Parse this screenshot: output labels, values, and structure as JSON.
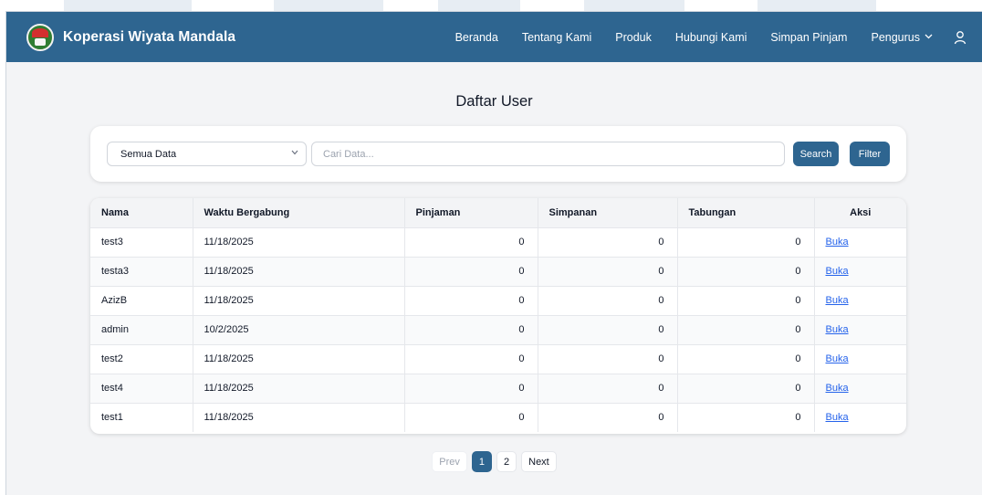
{
  "brand": {
    "name": "Koperasi Wiyata Mandala"
  },
  "nav": {
    "links": [
      "Beranda",
      "Tentang Kami",
      "Produk",
      "Hubungi Kami",
      "Simpan Pinjam",
      "Pengurus"
    ],
    "user_icon": "user-icon"
  },
  "page": {
    "title": "Daftar User"
  },
  "search": {
    "filter_selected": "Semua Data",
    "placeholder": "Cari Data...",
    "search_label": "Search",
    "filter_label": "Filter"
  },
  "table": {
    "headers": [
      "Nama",
      "Waktu Bergabung",
      "Pinjaman",
      "Simpanan",
      "Tabungan",
      "Aksi"
    ],
    "rows": [
      {
        "nama": "test3",
        "waktu": "11/18/2025",
        "pinjaman": "0",
        "simpanan": "0",
        "tabungan": "0",
        "aksi": "Buka"
      },
      {
        "nama": "testa3",
        "waktu": "11/18/2025",
        "pinjaman": "0",
        "simpanan": "0",
        "tabungan": "0",
        "aksi": "Buka"
      },
      {
        "nama": "AzizB",
        "waktu": "11/18/2025",
        "pinjaman": "0",
        "simpanan": "0",
        "tabungan": "0",
        "aksi": "Buka"
      },
      {
        "nama": "admin",
        "waktu": "10/2/2025",
        "pinjaman": "0",
        "simpanan": "0",
        "tabungan": "0",
        "aksi": "Buka"
      },
      {
        "nama": "test2",
        "waktu": "11/18/2025",
        "pinjaman": "0",
        "simpanan": "0",
        "tabungan": "0",
        "aksi": "Buka"
      },
      {
        "nama": "test4",
        "waktu": "11/18/2025",
        "pinjaman": "0",
        "simpanan": "0",
        "tabungan": "0",
        "aksi": "Buka"
      },
      {
        "nama": "test1",
        "waktu": "11/18/2025",
        "pinjaman": "0",
        "simpanan": "0",
        "tabungan": "0",
        "aksi": "Buka"
      }
    ]
  },
  "pagination": {
    "prev": "Prev",
    "pages": [
      "1",
      "2"
    ],
    "next": "Next",
    "current": "1"
  },
  "colors": {
    "primary": "#2e6590",
    "link": "#2563eb",
    "background": "#f3f4f6"
  }
}
